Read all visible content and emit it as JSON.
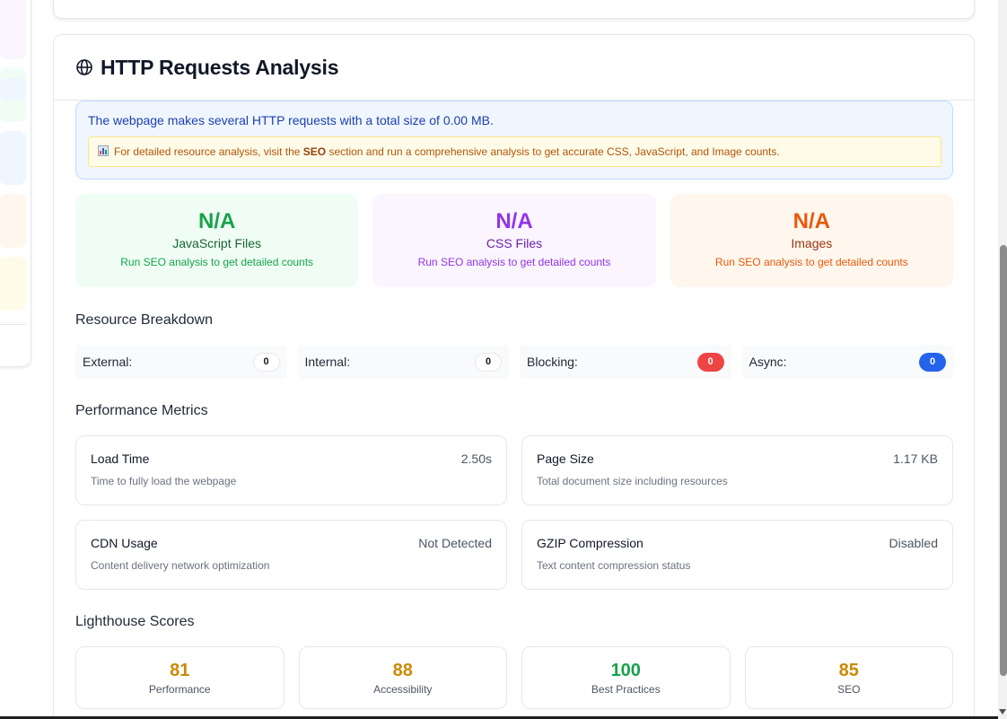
{
  "colors": {
    "green": "#16a34a",
    "purple": "#9333ea",
    "orange": "#ea580c",
    "red": "#ef4444",
    "blue": "#2563eb",
    "amber": "#ca8a04"
  },
  "header": {
    "icon": "globe-icon",
    "title": "HTTP Requests Analysis"
  },
  "info": {
    "text": "The webpage makes several HTTP requests with a total size of 0.00 MB.",
    "notice_icon": "bar-chart-icon",
    "notice_prefix": "For detailed resource analysis, visit the ",
    "notice_bold": "SEO",
    "notice_suffix": " section and run a comprehensive analysis to get accurate CSS, JavaScript, and Image counts."
  },
  "stats": [
    {
      "value": "N/A",
      "label": "JavaScript Files",
      "sub": "Run SEO analysis to get detailed counts"
    },
    {
      "value": "N/A",
      "label": "CSS Files",
      "sub": "Run SEO analysis to get detailed counts"
    },
    {
      "value": "N/A",
      "label": "Images",
      "sub": "Run SEO analysis to get detailed counts"
    }
  ],
  "breakdown": {
    "title": "Resource Breakdown",
    "items": [
      {
        "label": "External:",
        "count": "0"
      },
      {
        "label": "Internal:",
        "count": "0"
      },
      {
        "label": "Blocking:",
        "count": "0"
      },
      {
        "label": "Async:",
        "count": "0"
      }
    ]
  },
  "performance": {
    "title": "Performance Metrics",
    "metrics": [
      {
        "name": "Load Time",
        "value": "2.50s",
        "desc": "Time to fully load the webpage"
      },
      {
        "name": "Page Size",
        "value": "1.17 KB",
        "desc": "Total document size including resources"
      },
      {
        "name": "CDN Usage",
        "value": "Not Detected",
        "desc": "Content delivery network optimization"
      },
      {
        "name": "GZIP Compression",
        "value": "Disabled",
        "desc": "Text content compression status"
      }
    ]
  },
  "lighthouse": {
    "title": "Lighthouse Scores",
    "scores": [
      {
        "value": "81",
        "label": "Performance"
      },
      {
        "value": "88",
        "label": "Accessibility"
      },
      {
        "value": "100",
        "label": "Best Practices"
      },
      {
        "value": "85",
        "label": "SEO"
      }
    ]
  }
}
